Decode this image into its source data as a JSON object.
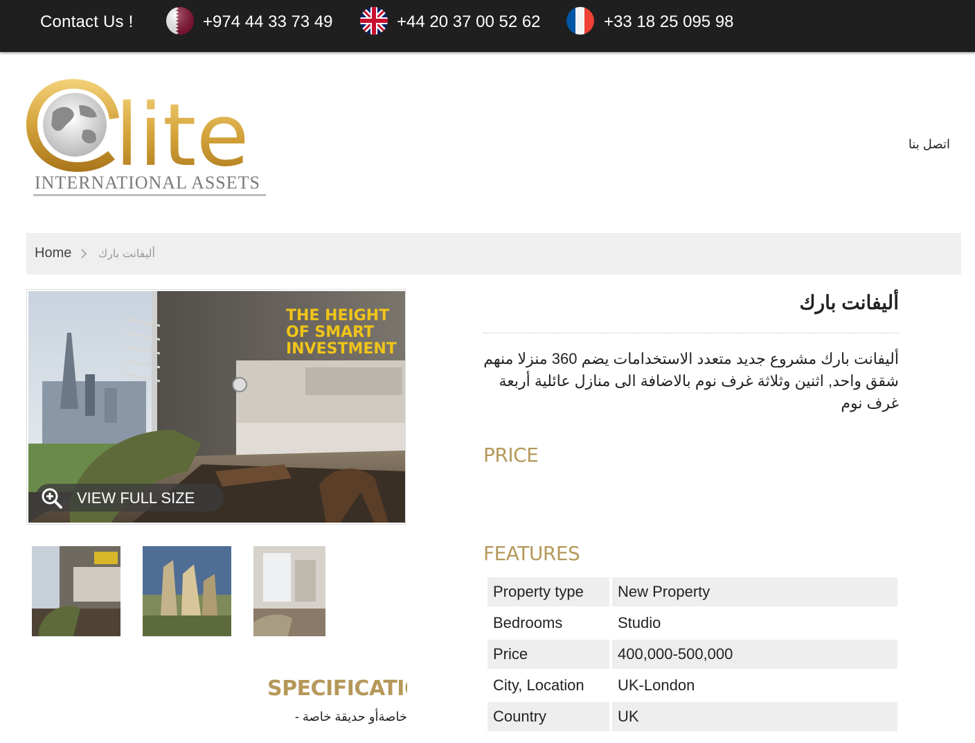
{
  "topbar": {
    "contact_label": "Contact Us !",
    "phones": [
      {
        "flag": "qatar-flag",
        "number": "+974 44 33 73 49"
      },
      {
        "flag": "uk-flag",
        "number": "+44 20 37 00 52 62"
      },
      {
        "flag": "france-flag",
        "number": "+33 18 25 095 98"
      }
    ]
  },
  "logo": {
    "word": "lite",
    "sub": "INTERNATIONAL ASSETS"
  },
  "nav": {
    "contact_ar": "اتصل بنا"
  },
  "breadcrumb": {
    "home": "Home",
    "current": "أليفانت بارك"
  },
  "gallery": {
    "overlay_text": "THE HEIGHT OF SMART INVESTMENT",
    "overlay_lines": [
      "THE HEIGHT",
      "OF SMART",
      "INVESTMENT"
    ],
    "view_full_size": "VIEW FULL SIZE"
  },
  "property": {
    "title": "أليفانت بارك",
    "description": "أليفانت بارك مشروع جديد متعدد الاستخدامات يضم 360 منزلا منهم شقق واحد, اثنين وثلاثة غرف نوم بالاضافة الى منازل عائلية أربعة غرف نوم"
  },
  "sections": {
    "price": "PRICE",
    "features": "FEATURES",
    "specifications": "SPECIFICATIONS"
  },
  "features": [
    {
      "label": "Property type",
      "value": "New Property"
    },
    {
      "label": "Bedrooms",
      "value": "Studio"
    },
    {
      "label": "Price",
      "value": "400,000-500,000"
    },
    {
      "label": "City, Location",
      "value": "UK-London"
    },
    {
      "label": "Country",
      "value": "UK"
    }
  ],
  "specifications_text": "خاصةأو حديقة خاصة -",
  "colors": {
    "accent": "#b5985a",
    "topbar": "#1f1f1f",
    "crumb_bg": "#efefef"
  }
}
